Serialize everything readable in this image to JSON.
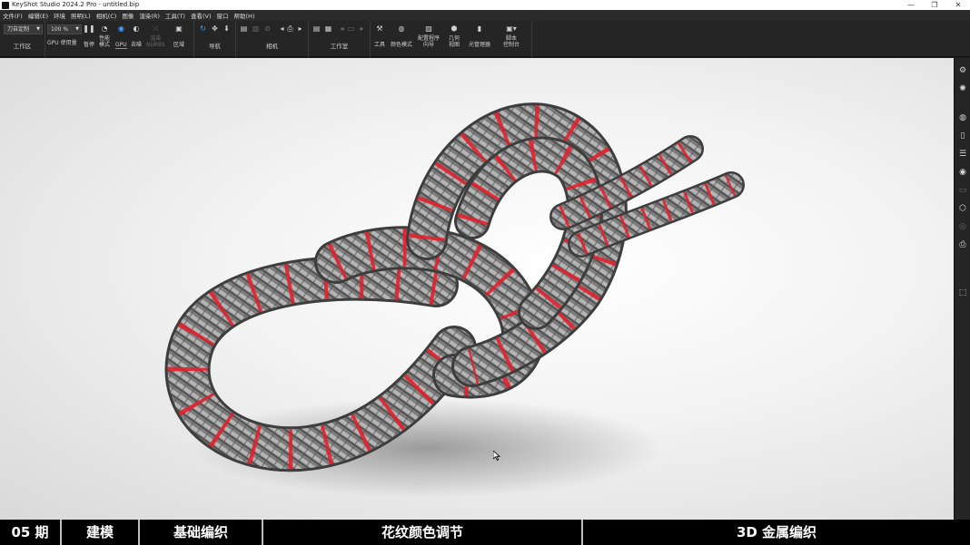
{
  "window": {
    "title": "KeyShot Studio 2024.2 Pro  -  untitled.bip",
    "minimize": "—",
    "maximize": "❐",
    "close": "✕"
  },
  "menu": [
    "文件(F)",
    "编辑(E)",
    "环境",
    "照明(L)",
    "相机(C)",
    "图像",
    "渲染(R)",
    "工具(T)",
    "查看(V)",
    "窗口",
    "帮助(H)"
  ],
  "ribbon": {
    "workspace": {
      "dropdown": "刀自定制",
      "label": "工作区"
    },
    "gpu": {
      "zoom": "100 %",
      "gpu_usage": "GPU 使用量",
      "pause": "暂停",
      "perf_mode": "性能\n模式",
      "gpu": "GPU",
      "denoise": "去噪",
      "nurbs": "渲染\nNURBS",
      "region": "区域"
    },
    "nav": {
      "label": "导航"
    },
    "camera": {
      "label": "相机"
    },
    "studio": {
      "label": "工作室"
    },
    "tools": {
      "tools": "工具",
      "color_mode": "颜色模式",
      "config_wizard": "配置程序\n向导",
      "geo_view": "几何\n视图",
      "light_manager": "光管理器",
      "script_console": "脚本\n控制台"
    }
  },
  "sidebar_icons": [
    "project-icon",
    "settings-gear-icon",
    "materials-icon",
    "library-icon",
    "scene-tree-icon",
    "render-icon",
    "monitor-icon",
    "cube-icon",
    "hdri-icon",
    "camera-icon",
    "region-select-icon"
  ],
  "caption": [
    "05 期",
    "建模",
    "基础编织",
    "花纹颜色调节",
    "3D 金属编织"
  ],
  "colors": {
    "accent": "#4aa3ff",
    "rope_metal": "#8a8a8a",
    "rope_stripe": "#e0212e",
    "caption_bg": "#000000"
  }
}
